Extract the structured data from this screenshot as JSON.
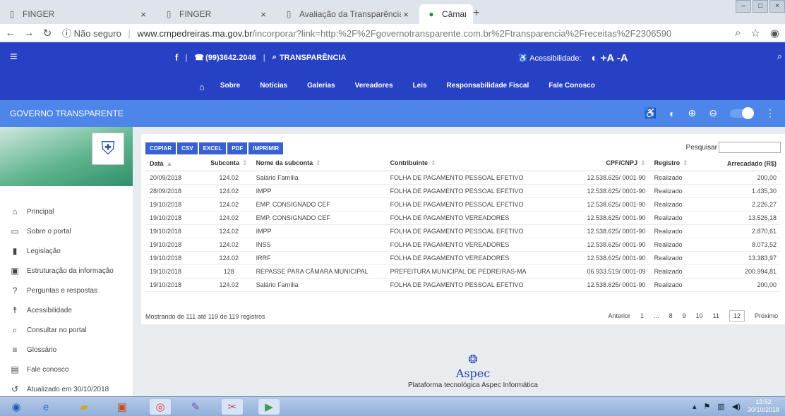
{
  "browser": {
    "tabs": [
      {
        "title": "FINGER",
        "active": false
      },
      {
        "title": "FINGER",
        "active": false
      },
      {
        "title": "Avaliação da Transparência dos /",
        "active": false
      },
      {
        "title": "Câmara Municipal de Pedreiras",
        "active": true
      }
    ],
    "url": {
      "security": "Não seguro",
      "host": "www.cmpedreiras.ma.gov.br",
      "path": "/incorporar?link=http:%2F%2Fgovernotransparente.com.br%2Ftransparencia%2Freceitas%2F2306590"
    }
  },
  "site": {
    "phone": "(99)3642.2046",
    "transparency": "TRANSPARÊNCIA",
    "accessibility": "Acessibilidade:",
    "font_controls": "+A -A",
    "nav": [
      "Sobre",
      "Notícias",
      "Galerias",
      "Vereadores",
      "Leis",
      "Responsabilidade Fiscal",
      "Fale Conosco"
    ]
  },
  "govbar": {
    "title": "GOVERNO TRANSPARENTE"
  },
  "sidebar": {
    "items": [
      {
        "label": "Principal",
        "icon": "home-icon",
        "glyph": "⌂"
      },
      {
        "label": "Sobre o portal",
        "icon": "folder-icon",
        "glyph": "▭"
      },
      {
        "label": "Legislação",
        "icon": "document-icon",
        "glyph": "▮"
      },
      {
        "label": "Estruturação da informação",
        "icon": "structure-icon",
        "glyph": "▣"
      },
      {
        "label": "Perguntas e respostas",
        "icon": "question-icon",
        "glyph": "?"
      },
      {
        "label": "Acessibilidade",
        "icon": "accessibility-icon",
        "glyph": "☨"
      },
      {
        "label": "Consultar no portal",
        "icon": "search-icon",
        "glyph": "⌕"
      },
      {
        "label": "Glossário",
        "icon": "list-icon",
        "glyph": "≡"
      },
      {
        "label": "Fale conosco",
        "icon": "chat-icon",
        "glyph": "▤"
      },
      {
        "label": "Atualizado em 30/10/2018",
        "icon": "history-icon",
        "glyph": "↺"
      }
    ]
  },
  "table": {
    "export_buttons": [
      "COPIAR",
      "CSV",
      "EXCEL",
      "PDF",
      "IMPRIMIR"
    ],
    "search_label": "Pesquisar",
    "columns": [
      "Data",
      "Subconta",
      "Nome da subconta",
      "Contribuinte",
      "CPF/CNPJ",
      "Registro",
      "Arrecadado (R$)"
    ],
    "rows": [
      [
        "20/09/2018",
        "124.02",
        "Salário Família",
        "FOLHA DE PAGAMENTO PESSOAL EFETIVO",
        "12.538.625/ 0001-90",
        "Realizado",
        "200,00"
      ],
      [
        "28/09/2018",
        "124.02",
        "IMPP",
        "FOLHA DE PAGAMENTO PESSOAL EFETIVO",
        "12.538.625/ 0001-90",
        "Realizado",
        "1.435,30"
      ],
      [
        "19/10/2018",
        "124.02",
        "EMP. CONSIGNADO CEF",
        "FOLHA DE PAGAMENTO PESSOAL EFETIVO",
        "12.538.625/ 0001-90",
        "Realizado",
        "2.226,27"
      ],
      [
        "19/10/2018",
        "124.02",
        "EMP. CONSIGNADO CEF",
        "FOLHA DE PAGAMENTO VEREADORES",
        "12.538.625/ 0001-90",
        "Realizado",
        "13.526,18"
      ],
      [
        "19/10/2018",
        "124.02",
        "IMPP",
        "FOLHA DE PAGAMENTO PESSOAL EFETIVO",
        "12.538.625/ 0001-90",
        "Realizado",
        "2.870,61"
      ],
      [
        "19/10/2018",
        "124.02",
        "INSS",
        "FOLHA DE PAGAMENTO VEREADORES",
        "12.538.625/ 0001-90",
        "Realizado",
        "8.073,52"
      ],
      [
        "19/10/2018",
        "124.02",
        "IRRF",
        "FOLHA DE PAGAMENTO VEREADORES",
        "12.538.625/ 0001-90",
        "Realizado",
        "13.383,97"
      ],
      [
        "19/10/2018",
        "128",
        "REPASSE PARA CÂMARA MUNICIPAL",
        "PREFEITURA MUNICIPAL DE PEDREIRAS-MA",
        "06.933.519/ 0001-09",
        "Realizado",
        "200.994,81"
      ],
      [
        "19/10/2018",
        "124.02",
        "Salário Família",
        "FOLHA DE PAGAMENTO PESSOAL EFETIVO",
        "12.538.625/ 0001-90",
        "Realizado",
        "200,00"
      ]
    ],
    "info": "Mostrando de 111 até 119 de 119 registros",
    "pager": {
      "prev": "Anterior",
      "pages": [
        "1",
        "...",
        "8",
        "9",
        "10",
        "11",
        "12"
      ],
      "current": "12",
      "next": "Próximo"
    }
  },
  "footer": {
    "brand": "Aspec",
    "tagline": "Plataforma tecnológica Aspec Informática"
  },
  "taskbar": {
    "time": "13:52",
    "date": "30/10/2018"
  }
}
